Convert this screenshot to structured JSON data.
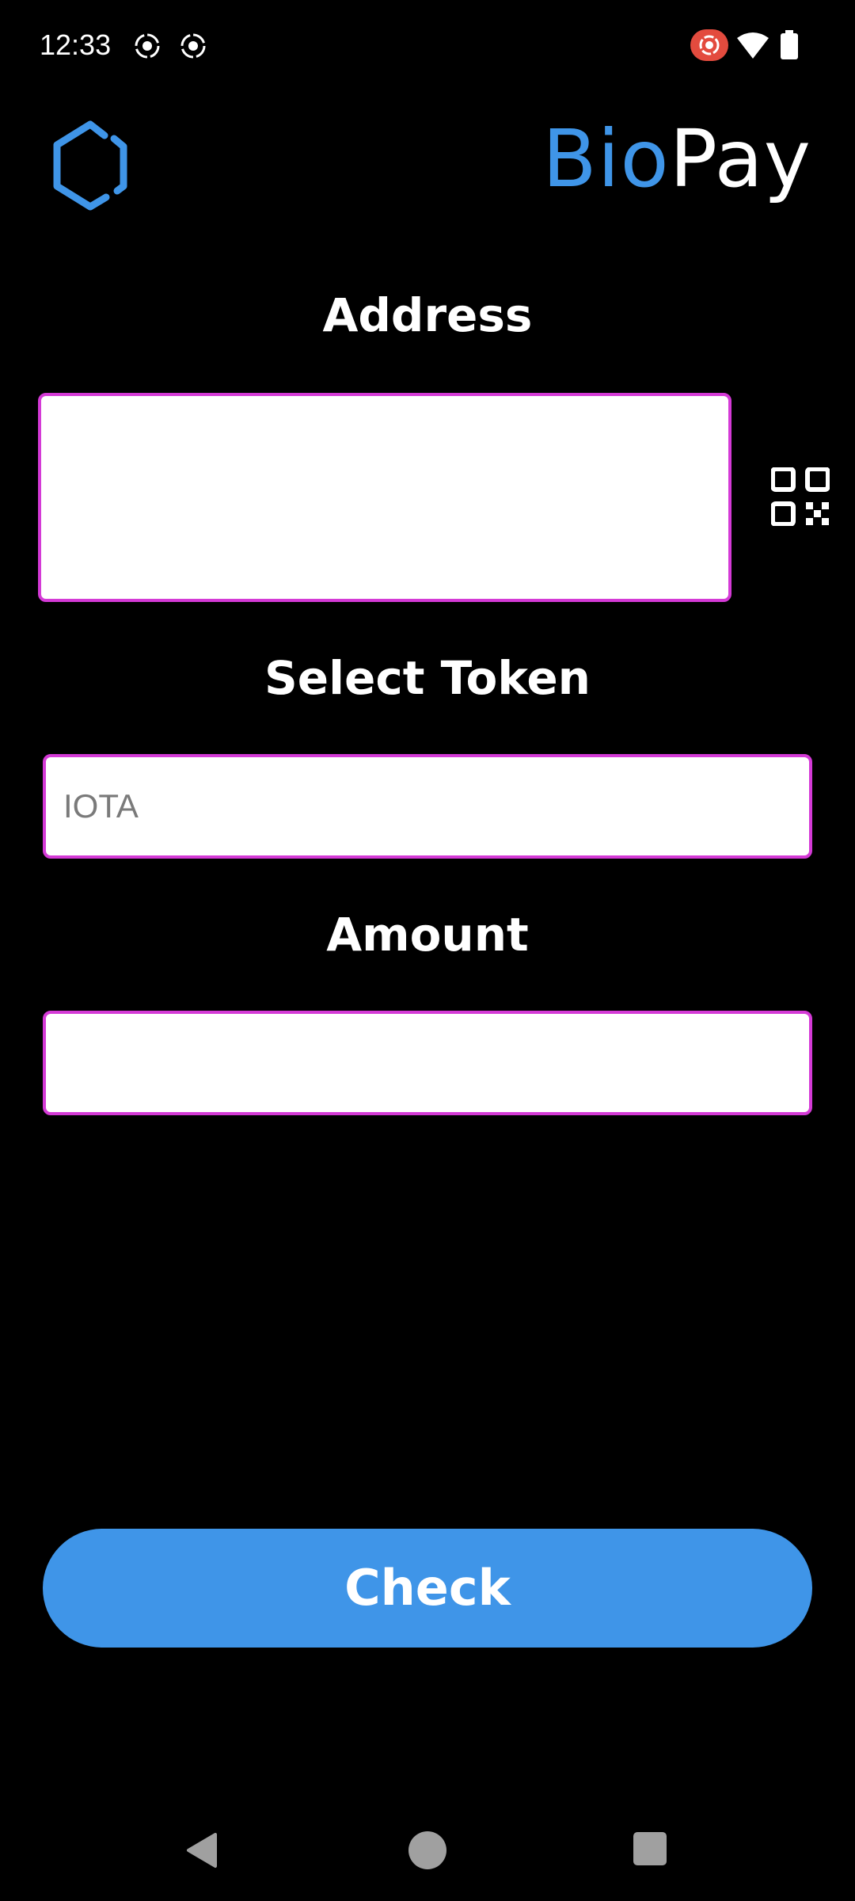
{
  "status_bar": {
    "time": "12:33",
    "icons": [
      "record-icon",
      "record-icon",
      "screen-record-icon",
      "wifi-icon",
      "battery-icon"
    ]
  },
  "header": {
    "brand_part1": "Bio",
    "brand_part2": "Pay",
    "logo": "hexagon-logo-icon"
  },
  "form": {
    "address_label": "Address",
    "address_value": "",
    "token_label": "Select Token",
    "token_placeholder": "IOTA",
    "amount_label": "Amount",
    "amount_value": ""
  },
  "actions": {
    "check_label": "Check"
  },
  "nav": {
    "icons": [
      "back-icon",
      "home-icon",
      "recents-icon"
    ]
  },
  "colors": {
    "accent": "#3f95e8",
    "field_border": "#d43ad6",
    "background": "#000000"
  }
}
